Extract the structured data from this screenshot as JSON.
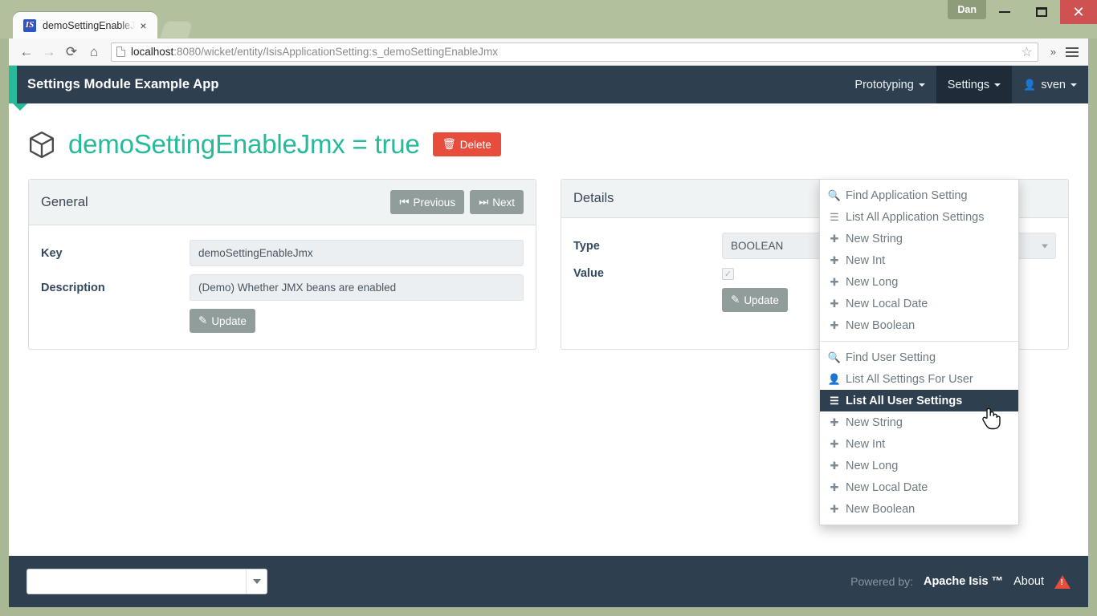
{
  "browser": {
    "tab_title": "demoSettingEnableJ",
    "tab_close_label": "×",
    "favicon_text": "IS",
    "url_host": "localhost",
    "url_rest": ":8080/wicket/entity/IsisApplicationSetting:s_demoSettingEnableJmx",
    "back_glyph": "←",
    "forward_glyph": "→",
    "reload_glyph": "⟳",
    "home_glyph": "⌂",
    "star_glyph": "☆",
    "overflow_glyph": "»",
    "os_user": "Dan",
    "close_glyph": "✕"
  },
  "navbar": {
    "brand": "Settings Module Example App",
    "items": [
      {
        "label": "Prototyping",
        "active": false
      },
      {
        "label": "Settings",
        "active": true
      }
    ],
    "user": {
      "label": "sven",
      "icon": "👤"
    }
  },
  "dropdown": {
    "group1": [
      {
        "label": "Find Application Setting",
        "icon": "🔍",
        "icon_name": "search-icon",
        "highlight": false
      },
      {
        "label": "List All Application Settings",
        "icon": "☰",
        "icon_name": "list-icon",
        "highlight": false
      },
      {
        "label": "New String",
        "icon": "✚",
        "icon_name": "plus-icon",
        "highlight": false
      },
      {
        "label": "New Int",
        "icon": "✚",
        "icon_name": "plus-icon",
        "highlight": false
      },
      {
        "label": "New Long",
        "icon": "✚",
        "icon_name": "plus-icon",
        "highlight": false
      },
      {
        "label": "New Local Date",
        "icon": "✚",
        "icon_name": "plus-icon",
        "highlight": false
      },
      {
        "label": "New Boolean",
        "icon": "✚",
        "icon_name": "plus-icon",
        "highlight": false
      }
    ],
    "group2": [
      {
        "label": "Find User Setting",
        "icon": "🔍",
        "icon_name": "search-icon",
        "highlight": false
      },
      {
        "label": "List All Settings For User",
        "icon": "👤",
        "icon_name": "user-icon",
        "highlight": false
      },
      {
        "label": "List All User Settings",
        "icon": "☰",
        "icon_name": "list-icon",
        "highlight": true
      },
      {
        "label": "New String",
        "icon": "✚",
        "icon_name": "plus-icon",
        "highlight": false
      },
      {
        "label": "New Int",
        "icon": "✚",
        "icon_name": "plus-icon",
        "highlight": false
      },
      {
        "label": "New Long",
        "icon": "✚",
        "icon_name": "plus-icon",
        "highlight": false
      },
      {
        "label": "New Local Date",
        "icon": "✚",
        "icon_name": "plus-icon",
        "highlight": false
      },
      {
        "label": "New Boolean",
        "icon": "✚",
        "icon_name": "plus-icon",
        "highlight": false
      }
    ]
  },
  "page": {
    "title": "demoSettingEnableJmx = true",
    "delete_label": "Delete",
    "delete_icon": "🗑",
    "delete_color": "#e74c3c"
  },
  "general_panel": {
    "title": "General",
    "previous_label": "Previous",
    "previous_icon": "⏮",
    "next_label": "Next",
    "next_icon": "⏭",
    "fields": [
      {
        "label": "Key",
        "value": "demoSettingEnableJmx"
      },
      {
        "label": "Description",
        "value": "(Demo) Whether JMX beans are enabled"
      }
    ],
    "update_label": "Update",
    "update_icon": "✎"
  },
  "details_panel": {
    "title": "Details",
    "type_label": "Type",
    "type_value": "BOOLEAN",
    "value_label": "Value",
    "value_checked": true,
    "check_glyph": "✓",
    "update_label": "Update",
    "update_icon": "✎"
  },
  "footer": {
    "select_value": "",
    "powered_by": "Powered by:",
    "product": "Apache Isis ™",
    "about": "About"
  },
  "theme": {
    "accent": "#26b99a",
    "navbar_bg": "#2e3f4f",
    "danger": "#e74c3c",
    "button_grey": "#919d9b"
  }
}
